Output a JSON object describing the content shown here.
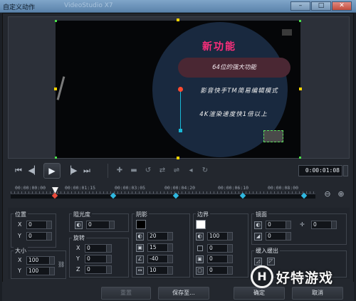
{
  "window": {
    "title": "自定义动作",
    "background_title": "VideoStudio X7"
  },
  "preview": {
    "title_text": "新功能",
    "pill_text": "64位的强大功能",
    "line1": "影音快手TM简易编辑模式",
    "line2": "4K渲染速度快1倍以上"
  },
  "transport": {
    "home_icon": "home-icon",
    "prev_icon": "previous-frame-icon",
    "play_icon": "play-icon",
    "next_icon": "next-frame-icon",
    "end_icon": "end-icon",
    "timecode": "0:00:01:08"
  },
  "timeline": {
    "ticks": [
      "00:00:00:00",
      "00:00:01:15",
      "00:00:03:05",
      "00:00:04:20",
      "00:00:06:10",
      "00:00:08:00"
    ]
  },
  "properties": {
    "position": {
      "label": "位置",
      "x_label": "X",
      "x": "0",
      "y_label": "Y",
      "y": "0"
    },
    "size": {
      "label": "大小",
      "x_label": "X",
      "x": "100",
      "y_label": "Y",
      "y": "100"
    },
    "opacity": {
      "label": "阻光度",
      "value": "0"
    },
    "rotation": {
      "label": "旋转",
      "x_label": "X",
      "x": "0",
      "y_label": "Y",
      "y": "0",
      "z_label": "Z",
      "z": "0"
    },
    "shadow": {
      "label": "阴影",
      "v1": "20",
      "v2": "15",
      "v3": "-40",
      "v4": "10"
    },
    "border": {
      "label": "边界",
      "v1": "100",
      "v2": "0",
      "v3": "0",
      "v4": "0"
    },
    "mirror": {
      "label": "镜面",
      "v1": "0",
      "v2": "0",
      "v3": "0"
    },
    "fade": {
      "label": "缓入缓出"
    }
  },
  "buttons": {
    "reset": "重置",
    "save_as": "保存至...",
    "ok": "确定",
    "cancel": "取消"
  },
  "watermark": {
    "logo": "H",
    "text": "好特游戏"
  }
}
